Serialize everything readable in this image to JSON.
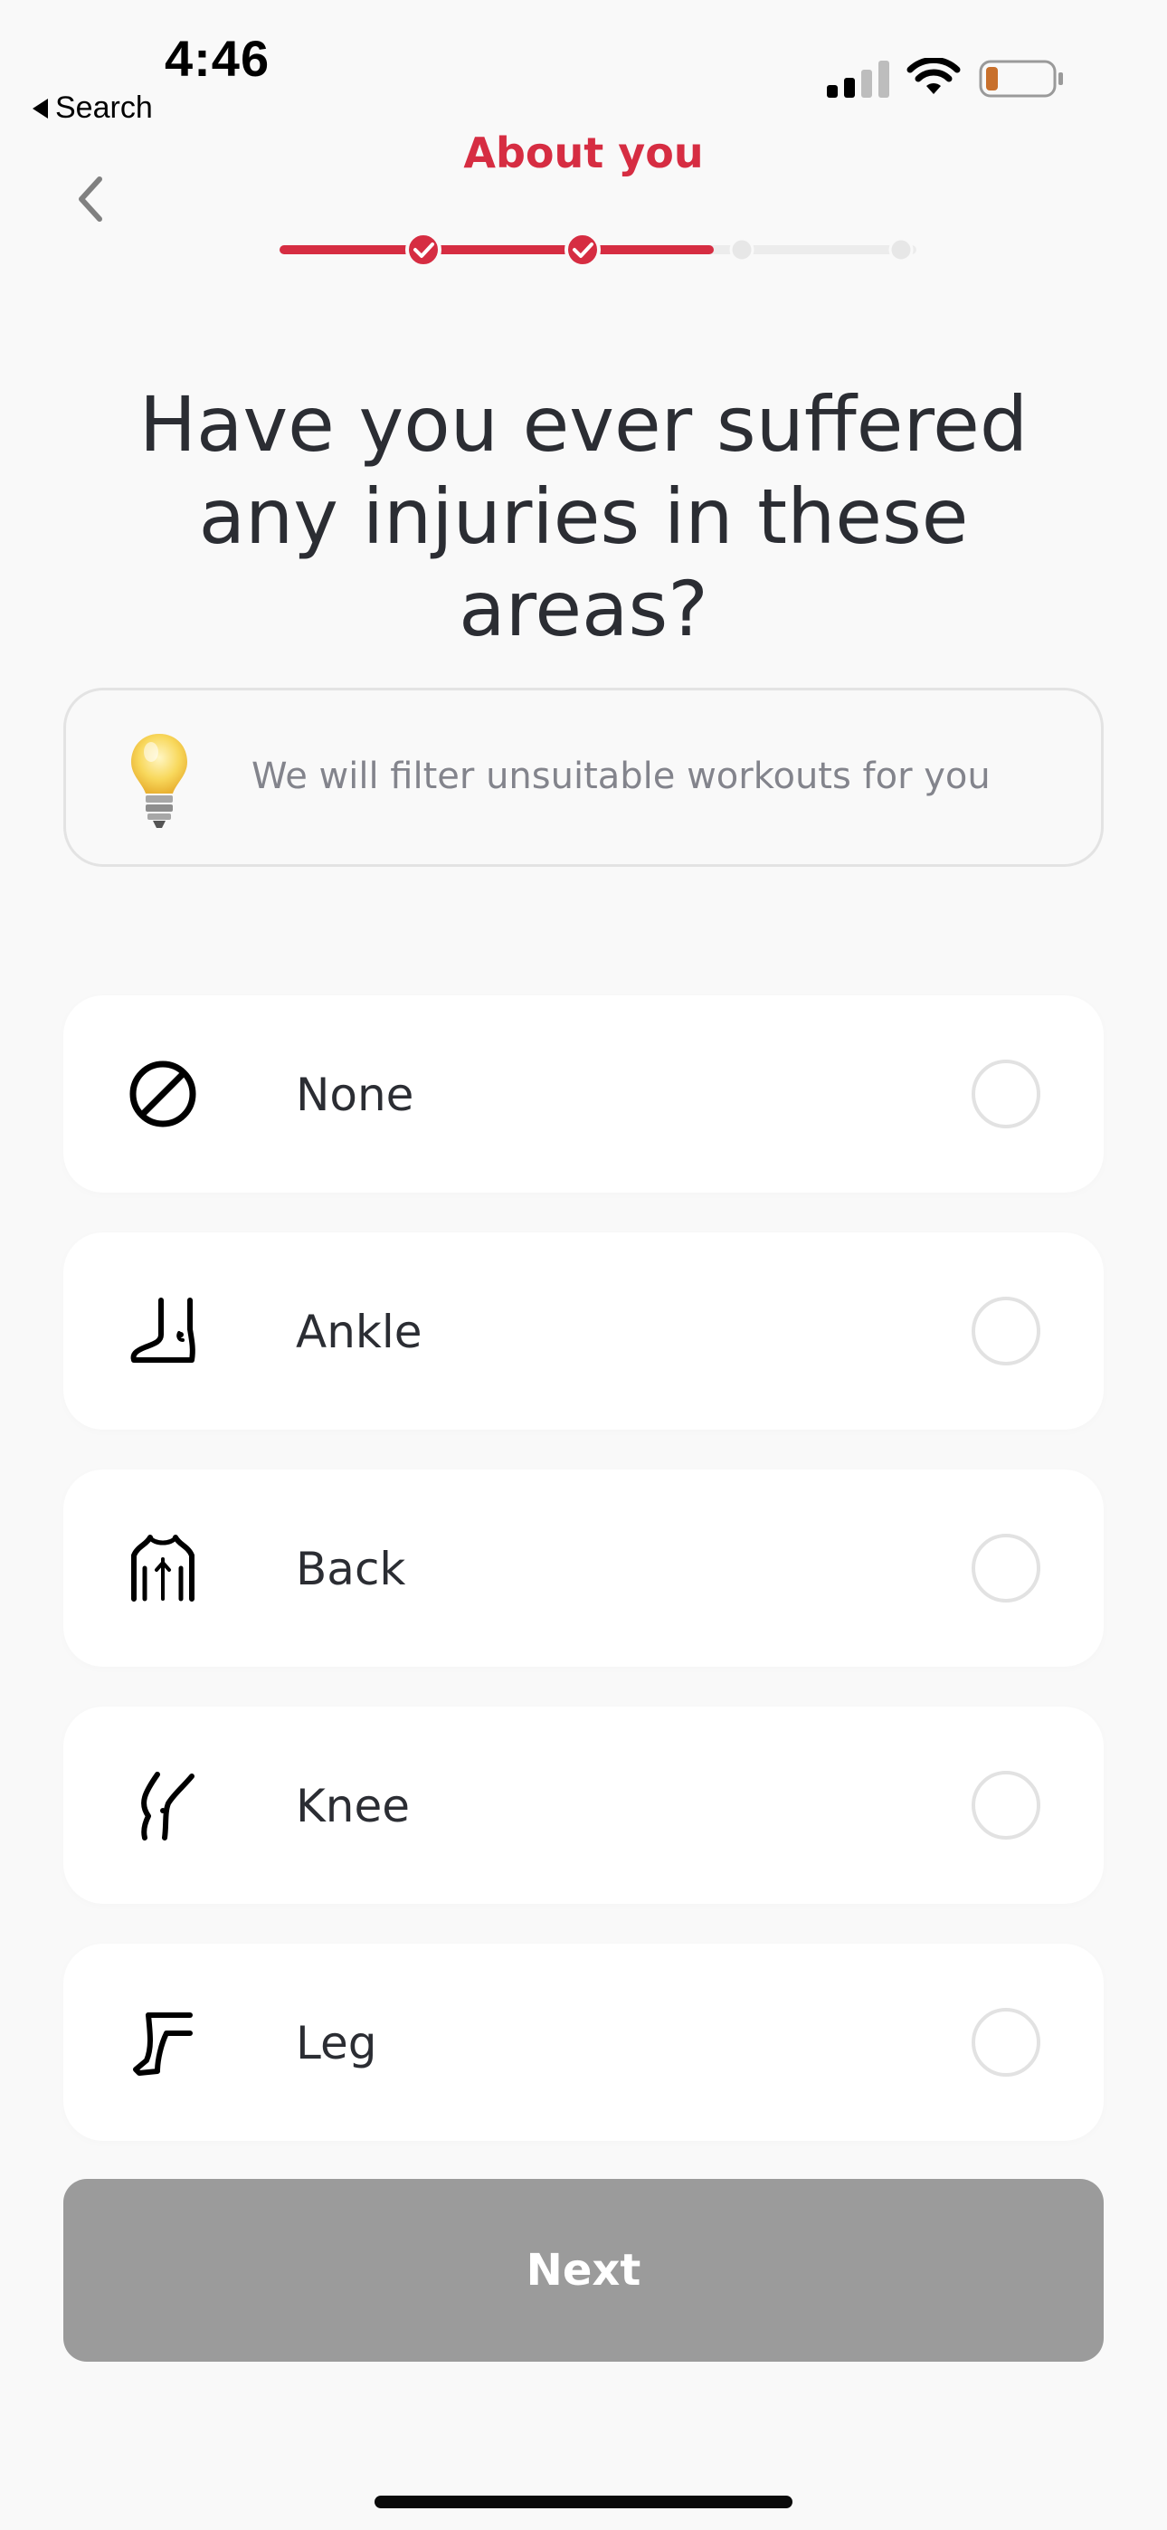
{
  "status_bar": {
    "time": "4:46",
    "back_app_label": "Search",
    "battery_color": "#c8702c"
  },
  "header": {
    "title": "About you",
    "back_icon": "chevron-left-icon",
    "progress": {
      "total_steps": 5,
      "completed_steps": 2,
      "fill_fraction": 0.6,
      "accent_color": "#d62d42",
      "track_color": "#ececec"
    }
  },
  "question": {
    "text": "Have you ever suffered any injuries in these areas?"
  },
  "tip": {
    "icon": "lightbulb-icon",
    "text": "We will filter unsuitable workouts for you"
  },
  "options": [
    {
      "label": "None",
      "icon": "no-symbol-icon",
      "selected": false
    },
    {
      "label": "Ankle",
      "icon": "ankle-icon",
      "selected": false
    },
    {
      "label": "Back",
      "icon": "back-icon",
      "selected": false
    },
    {
      "label": "Knee",
      "icon": "knee-icon",
      "selected": false
    },
    {
      "label": "Leg",
      "icon": "leg-icon",
      "selected": false
    }
  ],
  "next_button": {
    "label": "Next",
    "enabled": false,
    "disabled_color": "#9b9b9b"
  }
}
